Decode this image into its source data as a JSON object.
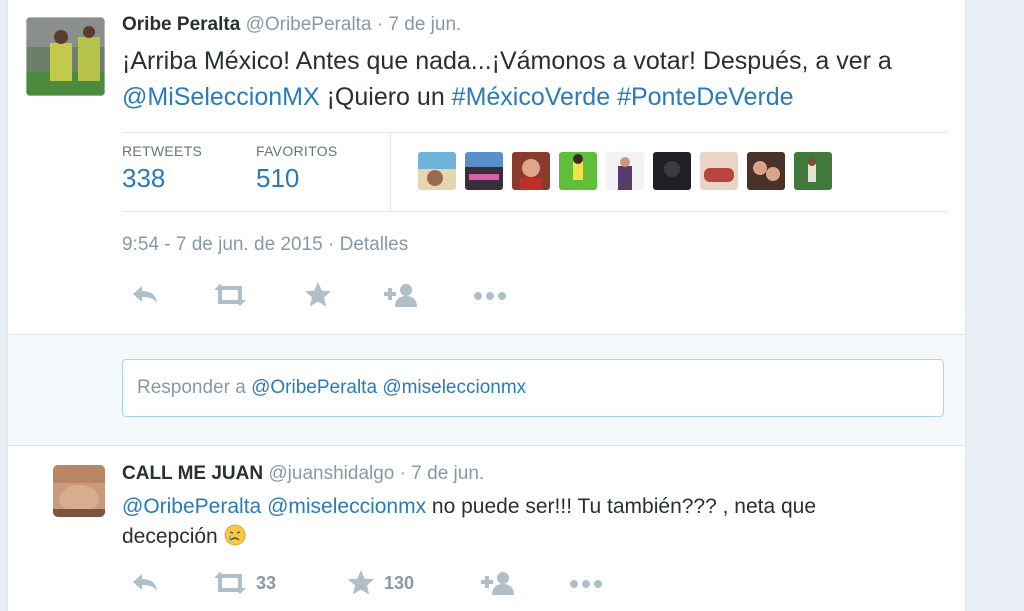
{
  "main_tweet": {
    "fullname": "Oribe Peralta",
    "username": "@OribePeralta",
    "separator": "·",
    "time": "7 de jun.",
    "text_line1": "¡Arriba México! Antes que nada...¡Vámonos a votar! Después, a ver a",
    "mention": "@MiSeleccionMX",
    "text_mid": " ¡Quiero un ",
    "hashtag1": "#MéxicoVerde",
    "hashtag2": "#PonteDeVerde",
    "stats": {
      "retweets_label": "RETWEETS",
      "retweets_value": "338",
      "favorites_label": "FAVORITOS",
      "favorites_value": "510"
    },
    "timestamp": "9:54 - 7 de jun. de 2015",
    "details_link": "Detalles",
    "actions": [
      "reply-icon",
      "retweet-icon",
      "favorite-icon",
      "follow-icon",
      "more-icon"
    ]
  },
  "reply_box": {
    "prefix": "Responder a ",
    "mention1": "@OribePeralta",
    "mention2": "@miseleccionmx"
  },
  "reply_tweet": {
    "fullname": "CALL ME JUAN",
    "username": "@juanshidalgo",
    "separator": "·",
    "time": "7 de jun.",
    "mention1": "@OribePeralta",
    "mention2": "@miseleccionmx",
    "text_rest": " no puede ser!!! Tu también??? , neta que",
    "text_line2": "decepción",
    "emoji": "crying-face-emoji",
    "retweet_count": "33",
    "favorite_count": "130"
  },
  "colors": {
    "link": "#2b7bb9",
    "muted": "#8899a6",
    "action_icon": "#b0bec8",
    "text": "#292f33",
    "reply_border": "#a8d3ed"
  }
}
